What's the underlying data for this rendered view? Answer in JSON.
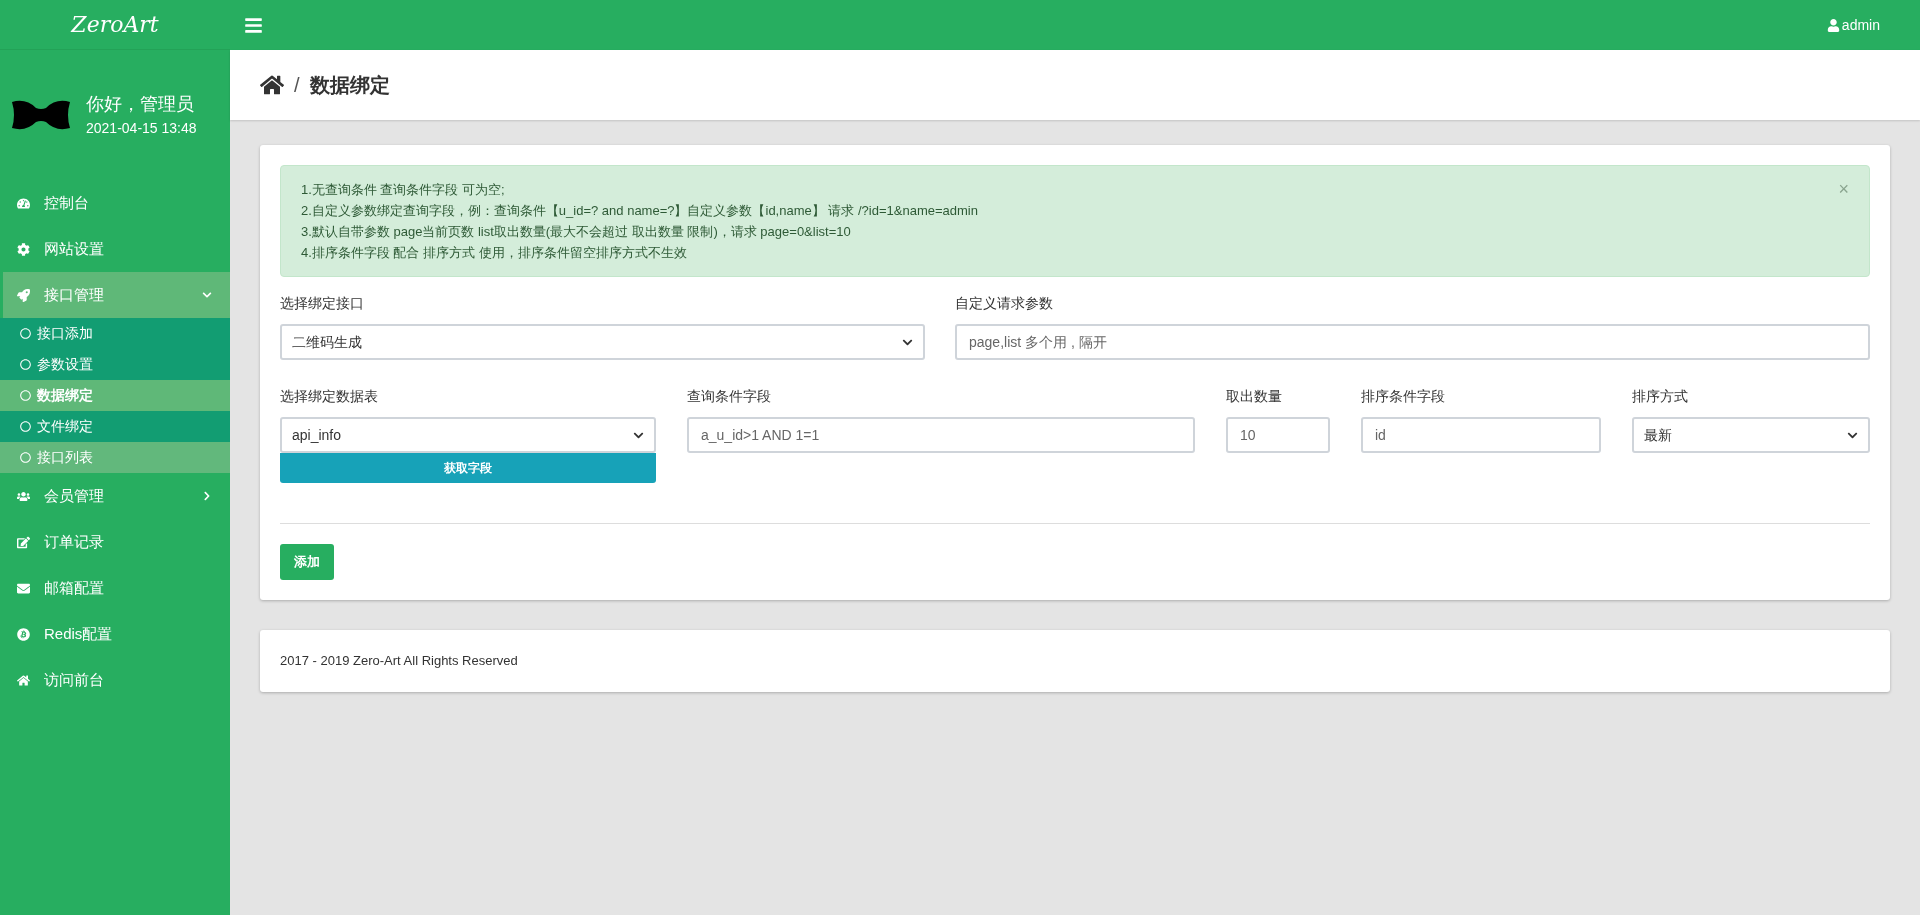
{
  "brand": "ZeroArt",
  "user": {
    "name": "admin"
  },
  "profile": {
    "greeting": "你好，管理员",
    "time": "2021-04-15 13:48"
  },
  "sidebar": {
    "items": [
      {
        "label": "控制台",
        "kind": "link"
      },
      {
        "label": "网站设置",
        "kind": "link"
      },
      {
        "label": "接口管理",
        "kind": "group",
        "expanded": true,
        "children": [
          {
            "label": "接口添加",
            "selected": false,
            "hovered": false
          },
          {
            "label": "参数设置",
            "selected": false,
            "hovered": false
          },
          {
            "label": "数据绑定",
            "selected": true,
            "hovered": false
          },
          {
            "label": "文件绑定",
            "selected": false,
            "hovered": false
          },
          {
            "label": "接口列表",
            "selected": false,
            "hovered": true
          }
        ]
      },
      {
        "label": "会员管理",
        "kind": "group",
        "expanded": false
      },
      {
        "label": "订单记录",
        "kind": "link"
      },
      {
        "label": "邮箱配置",
        "kind": "link"
      },
      {
        "label": "Redis配置",
        "kind": "link"
      },
      {
        "label": "访问前台",
        "kind": "link"
      }
    ]
  },
  "breadcrumb": {
    "separator": "/",
    "title": "数据绑定"
  },
  "alert": {
    "lines": [
      "1.无查询条件 查询条件字段 可为空;",
      "2.自定义参数绑定查询字段，例：查询条件【u_id=? and name=?】自定义参数【id,name】 请求 /?id=1&name=admin",
      "3.默认自带参数 page当前页数 list取出数量(最大不会超过 取出数量 限制)，请求 page=0&list=10",
      "4.排序条件字段 配合 排序方式 使用，排序条件留空排序方式不生效"
    ],
    "close": "×"
  },
  "form": {
    "row1": [
      {
        "kind": "select",
        "label": "选择绑定接口",
        "value": "二维码生成"
      },
      {
        "kind": "input",
        "label": "自定义请求参数",
        "placeholder": "page,list 多个用 , 隔开"
      }
    ],
    "row2": [
      {
        "kind": "select",
        "label": "选择绑定数据表",
        "value": "api_info",
        "button": "获取字段"
      },
      {
        "kind": "input",
        "label": "查询条件字段",
        "placeholder": "a_u_id>1 AND 1=1"
      },
      {
        "kind": "input",
        "label": "取出数量",
        "placeholder": "10"
      },
      {
        "kind": "input",
        "label": "排序条件字段",
        "placeholder": "id"
      },
      {
        "kind": "select",
        "label": "排序方式",
        "value": "最新"
      }
    ],
    "submit": "添加"
  },
  "footer": "2017 - 2019 Zero-Art All Rights Reserved"
}
